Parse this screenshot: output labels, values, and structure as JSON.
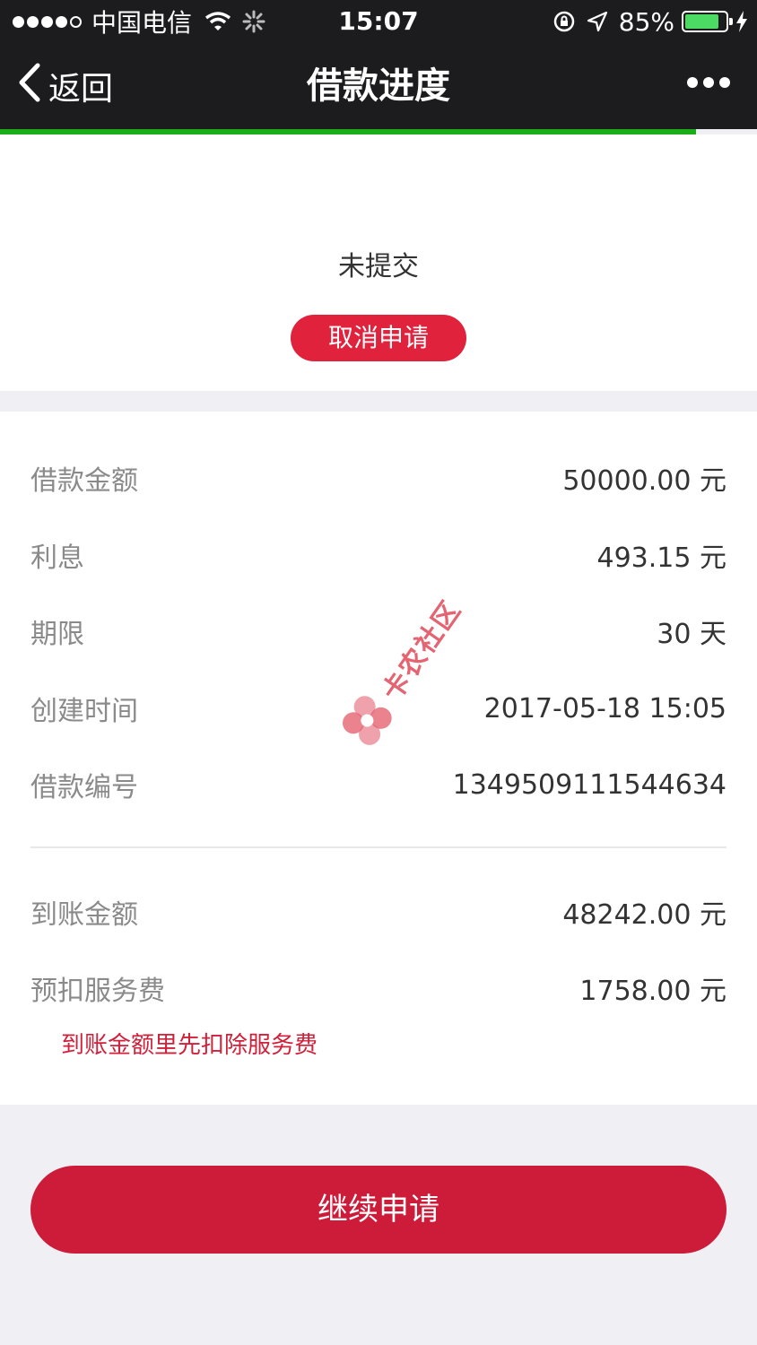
{
  "status_bar": {
    "carrier": "中国电信",
    "time": "15:07",
    "battery": "85%",
    "battery_level": 0.85,
    "icons": [
      "signal-dots",
      "wifi-icon",
      "loading-icon",
      "rotation-lock-icon",
      "location-icon",
      "battery-icon",
      "charging-icon"
    ]
  },
  "nav": {
    "back_label": "返回",
    "title": "借款进度",
    "more_icon": "more-icon"
  },
  "page_progress": 0.92,
  "colors": {
    "progress": "#1aad19",
    "accent_red": "#e0223d",
    "button_red": "#cd1b3a",
    "note_red": "#d0203a"
  },
  "status": {
    "text": "未提交",
    "cancel_label": "取消申请"
  },
  "details": [
    {
      "label": "借款金额",
      "value": "50000.00 元"
    },
    {
      "label": "利息",
      "value": "493.15  元"
    },
    {
      "label": "期限",
      "value": "30 天"
    },
    {
      "label": "创建时间",
      "value": "2017-05-18 15:05"
    },
    {
      "label": "借款编号",
      "value": "1349509111544634"
    }
  ],
  "fees": [
    {
      "label": "到账金额",
      "value": "48242.00 元"
    },
    {
      "label": "预扣服务费",
      "value": "1758.00  元"
    }
  ],
  "fee_note": "到账金额里先扣除服务费",
  "continue_label": "继续申请",
  "watermark": "卡农社区"
}
